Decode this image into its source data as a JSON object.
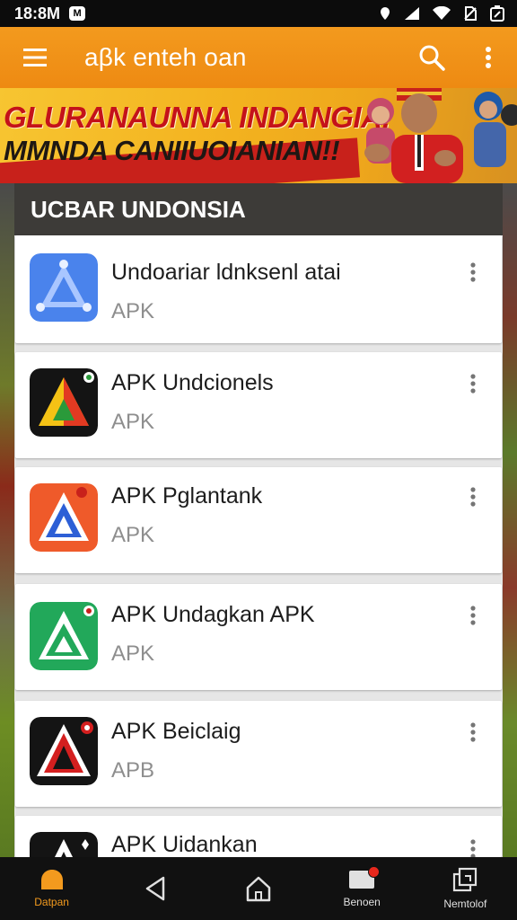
{
  "status_bar": {
    "time": "18:8M",
    "app_icon_glyph": "M",
    "icons": [
      "location-icon",
      "signal-icon",
      "wifi-icon",
      "no-sim-icon",
      "battery-icon"
    ]
  },
  "app_bar": {
    "title": "aβk enteh oan",
    "menu_icon": "hamburger-menu-icon",
    "search_icon": "search-icon",
    "more_icon": "more-vertical-icon",
    "color": "#f39a1e"
  },
  "banner": {
    "line1": "GLURANAUNNA INDANGIA!",
    "line2": "MMNDA CANIIUOIANIAN!!"
  },
  "section": {
    "title": "UCBAR UNDONSIA"
  },
  "apps": [
    {
      "name": "Undoariar ldnksenl atai",
      "sub": "APK",
      "icon": "blue-triangle-icon"
    },
    {
      "name": "APK Undcionels",
      "sub": "APK",
      "icon": "multicolor-triangle-icon"
    },
    {
      "name": "APK Pglantank",
      "sub": "APK",
      "icon": "orange-triangle-icon"
    },
    {
      "name": "APK Undagkan APK",
      "sub": "APK",
      "icon": "green-triangle-icon"
    },
    {
      "name": "APK Beiclaig",
      "sub": "APB",
      "icon": "red-black-triangle-icon"
    },
    {
      "name": "APK Uidankan",
      "sub": "",
      "icon": "black-triangle-icon"
    }
  ],
  "bottom_nav": [
    {
      "label": "Datpan",
      "icon": "home-blob-icon",
      "active": true
    },
    {
      "label": "",
      "icon": "back-icon",
      "active": false
    },
    {
      "label": "",
      "icon": "home-icon",
      "active": false
    },
    {
      "label": "Benoen",
      "icon": "inbox-icon",
      "active": false,
      "badge": true
    },
    {
      "label": "Nemtolof",
      "icon": "apps-icon",
      "active": false
    }
  ]
}
